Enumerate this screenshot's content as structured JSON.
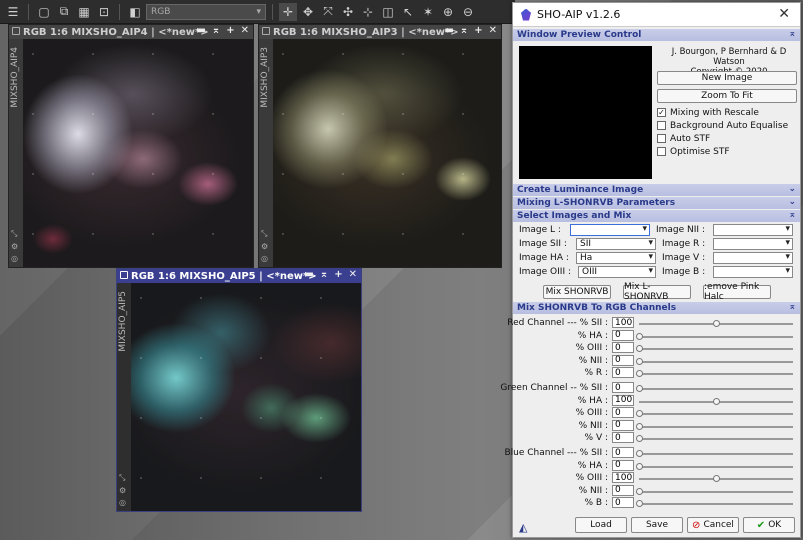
{
  "toolbar": {
    "colorspace_select": "RGB"
  },
  "windows": [
    {
      "title": "RGB 1:6 MIXSHO_AIP4 | <*new*>",
      "side_label": "MIXSHO_AIP4"
    },
    {
      "title": "RGB 1:6 MIXSHO_AIP3 | <*new*>",
      "side_label": "MIXSHO_AIP3"
    },
    {
      "title": "RGB 1:6 MIXSHO_AIP5 | <*new*>",
      "side_label": "MIXSHO_AIP5"
    }
  ],
  "window_controls": {
    "minimize": "▬",
    "shade": "⌅",
    "maximize": "+",
    "close": "✕"
  },
  "dialog": {
    "title": "SHO-AIP v1.2.6",
    "close": "✕",
    "sections": {
      "preview": "Window Preview Control",
      "luminance": "Create Luminance Image",
      "mixing": "Mixing L-SHONRVB Parameters",
      "select": "Select Images and Mix",
      "channels": "Mix SHONRVB To RGB Channels"
    },
    "credits": [
      "J. Bourgon, P Bernhard & D Watson",
      "— Copyright © 2020 —"
    ],
    "buttons": {
      "new_image": "New Image",
      "zoom_fit": "Zoom To Fit",
      "mix_shonrvb": "Mix SHONRVB",
      "mix_lshonrvb": "Mix L-SHONRVB",
      "remove_pink": ":emove Pink Halc",
      "load": "Load",
      "save": "Save",
      "cancel": "Cancel",
      "ok": "OK"
    },
    "options": [
      {
        "label": "Mixing with Rescale",
        "checked": "✓"
      },
      {
        "label": "Background Auto Equalise",
        "checked": ""
      },
      {
        "label": "Auto STF",
        "checked": ""
      },
      {
        "label": "Optimise STF",
        "checked": ""
      }
    ],
    "images_left": [
      {
        "label": "Image L :",
        "value": ""
      },
      {
        "label": "Image  SII :",
        "value": "SII"
      },
      {
        "label": "Image  HA :",
        "value": "Ha"
      },
      {
        "label": "Image  OIII :",
        "value": "OIII"
      }
    ],
    "images_right": [
      {
        "label": "Image  NII :",
        "value": ""
      },
      {
        "label": "Image  R :",
        "value": ""
      },
      {
        "label": "Image  V :",
        "value": ""
      },
      {
        "label": "Image  B :",
        "value": ""
      }
    ],
    "red": [
      {
        "label": "Red Channel --- % SII :",
        "value": "100",
        "level": 1.0
      },
      {
        "label": "% HA :",
        "value": "0",
        "level": 0
      },
      {
        "label": "% OIII :",
        "value": "0",
        "level": 0
      },
      {
        "label": "% NII :",
        "value": "0",
        "level": 0
      },
      {
        "label": "% R :",
        "value": "0",
        "level": 0
      }
    ],
    "green": [
      {
        "label": "Green Channel -- % SII :",
        "value": "0",
        "level": 0
      },
      {
        "label": "% HA :",
        "value": "100",
        "level": 1.0
      },
      {
        "label": "% OIII :",
        "value": "0",
        "level": 0
      },
      {
        "label": "% NII :",
        "value": "0",
        "level": 0
      },
      {
        "label": "% V :",
        "value": "0",
        "level": 0
      }
    ],
    "blue": [
      {
        "label": "Blue Channel --- % SII :",
        "value": "0",
        "level": 0
      },
      {
        "label": "% HA :",
        "value": "0",
        "level": 0
      },
      {
        "label": "% OIII :",
        "value": "100",
        "level": 1.0
      },
      {
        "label": "% NII :",
        "value": "0",
        "level": 0
      },
      {
        "label": "% B :",
        "value": "0",
        "level": 0
      }
    ]
  }
}
